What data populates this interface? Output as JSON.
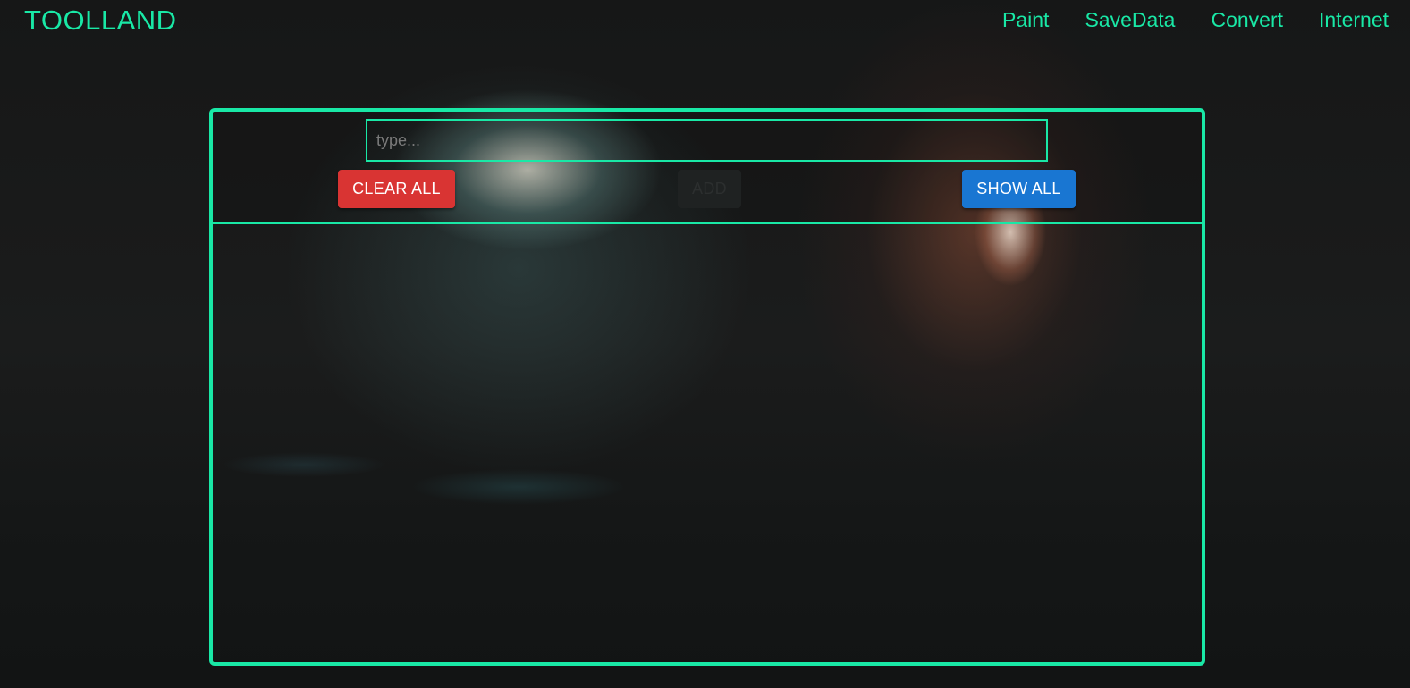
{
  "header": {
    "brand": "TOOLLAND",
    "nav": [
      "Paint",
      "SaveData",
      "Convert",
      "Internet"
    ]
  },
  "form": {
    "placeholder": "type...",
    "value": ""
  },
  "buttons": {
    "clear_all": "CLEAR ALL",
    "add": "ADD",
    "show_all": "SHOW ALL"
  },
  "colors": {
    "accent": "#19e8a6",
    "clear_button": "#d93433",
    "show_button": "#1976d2",
    "background": "#151616"
  },
  "items": []
}
